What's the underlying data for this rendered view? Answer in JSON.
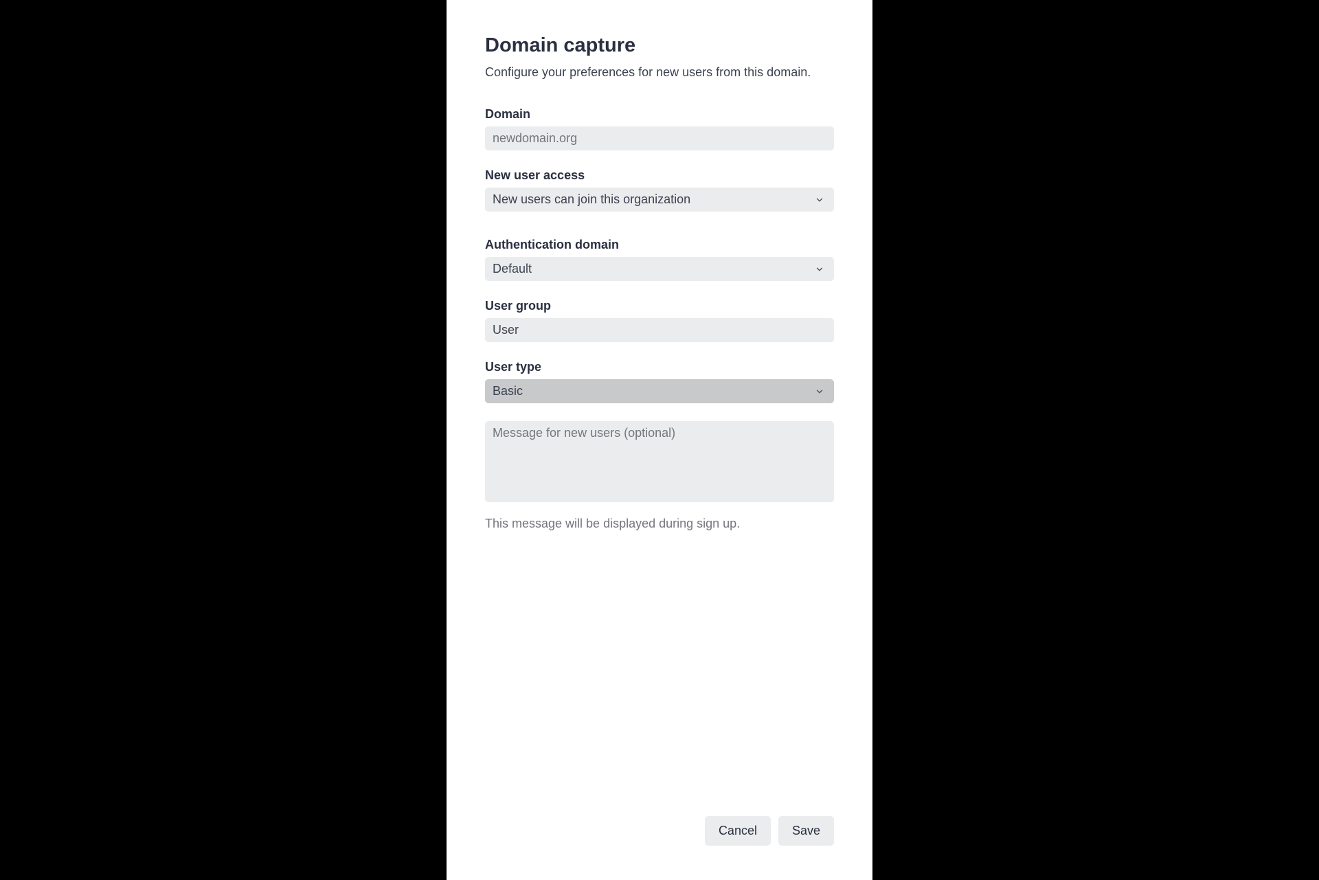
{
  "title": "Domain capture",
  "subtitle": "Configure your preferences for new users from this domain.",
  "form": {
    "domain": {
      "label": "Domain",
      "value": "newdomain.org"
    },
    "new_user_access": {
      "label": "New user access",
      "value": "New users can join this organization"
    },
    "auth_domain": {
      "label": "Authentication domain",
      "value": "Default"
    },
    "user_group": {
      "label": "User group",
      "value": "User"
    },
    "user_type": {
      "label": "User type",
      "value": "Basic"
    },
    "message": {
      "placeholder": "Message for new users (optional)",
      "hint": "This message will be displayed during sign up."
    }
  },
  "buttons": {
    "cancel": "Cancel",
    "save": "Save"
  }
}
